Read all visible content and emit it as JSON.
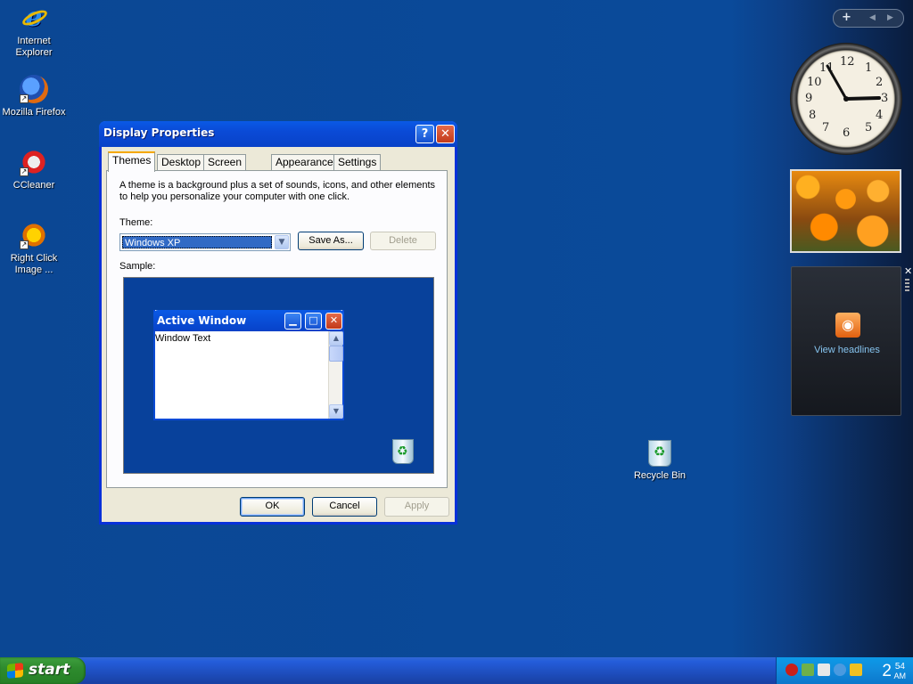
{
  "desktop": {
    "icons": [
      {
        "label": "Internet Explorer",
        "icon": "internet-explorer-icon"
      },
      {
        "label": "Mozilla Firefox",
        "icon": "firefox-icon"
      },
      {
        "label": "CCleaner",
        "icon": "ccleaner-icon"
      },
      {
        "label": "Right Click Image ...",
        "icon": "right-click-image-icon"
      },
      {
        "label": "Recycle Bin",
        "icon": "recycle-bin-icon"
      }
    ]
  },
  "dialog": {
    "title": "Display Properties",
    "help_glyph": "?",
    "close_glyph": "✕",
    "tabs": [
      "Themes",
      "Desktop",
      "Screen Saver",
      "Appearance",
      "Settings"
    ],
    "active_tab": "Themes",
    "description": "A theme is a background plus a set of sounds, icons, and other elements to help you personalize your computer with one click.",
    "theme_label": "Theme:",
    "theme_value": "Windows XP",
    "save_as_label": "Save As...",
    "delete_label": "Delete",
    "sample_label": "Sample:",
    "sample": {
      "window_title": "Active Window",
      "window_text": "Window Text"
    },
    "ok_label": "OK",
    "cancel_label": "Cancel",
    "apply_label": "Apply"
  },
  "sidebar": {
    "add_glyph": "+",
    "prev_glyph": "◀",
    "next_glyph": "▶",
    "clock_numbers": [
      "12",
      "1",
      "2",
      "3",
      "4",
      "5",
      "6",
      "7",
      "8",
      "9",
      "10",
      "11"
    ],
    "feed_label": "View headlines",
    "feed_close": "✕"
  },
  "taskbar": {
    "start_label": "start",
    "clock_hour": "2",
    "clock_minute": "54",
    "clock_ampm": "AM"
  },
  "colors": {
    "desktop": "#0a4a9a",
    "title_bar": "#0a4ad6",
    "start_button": "#2e8b2e",
    "tray": "#118adb"
  }
}
